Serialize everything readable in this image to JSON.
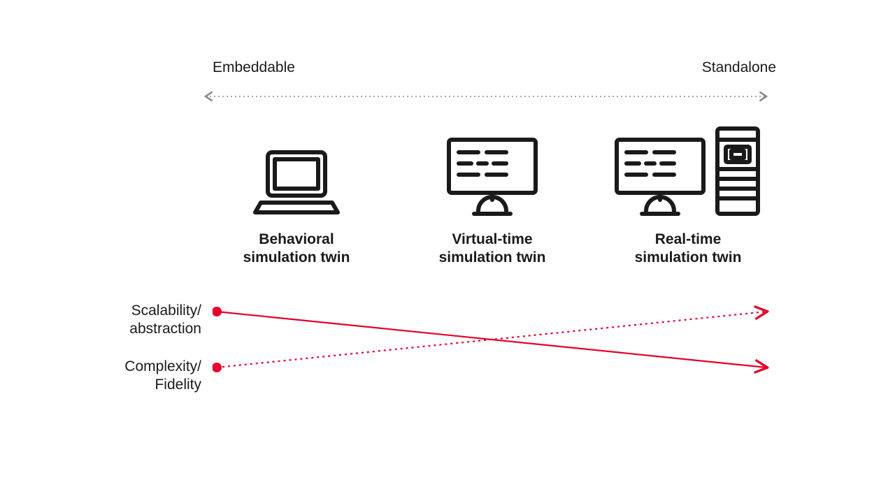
{
  "axis": {
    "left_label": "Embeddable",
    "right_label": "Standalone"
  },
  "items": [
    {
      "label_line1": "Behavioral",
      "label_line2": "simulation twin",
      "icon": "laptop"
    },
    {
      "label_line1": "Virtual-time",
      "label_line2": "simulation twin",
      "icon": "monitor"
    },
    {
      "label_line1": "Real-time",
      "label_line2": "simulation twin",
      "icon": "workstation"
    }
  ],
  "dimensions": {
    "scalability": {
      "line1": "Scalability/",
      "line2": "abstraction"
    },
    "complexity": {
      "line1": "Complexity/",
      "line2": "Fidelity"
    }
  },
  "colors": {
    "accent": "#E4002B",
    "axis": "#8a8a8a",
    "ink": "#1a1a1a"
  }
}
